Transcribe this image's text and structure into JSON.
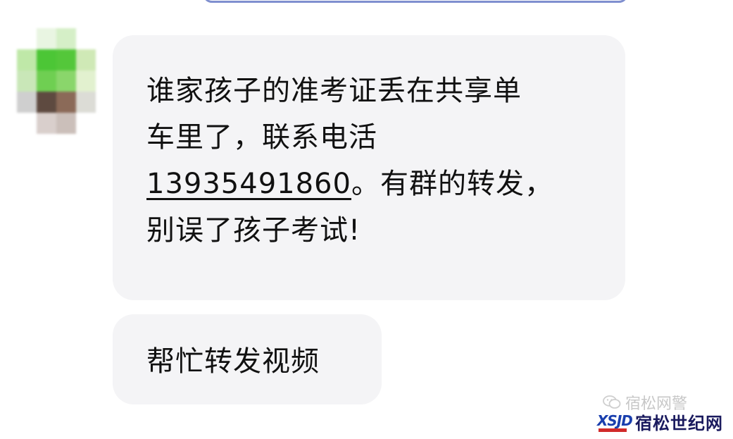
{
  "chat": {
    "messages": [
      {
        "line1": "谁家孩子的准考证丢在共享单",
        "line2": "车里了，联系电活",
        "phone": "13935491860",
        "line3_rest": "。有群的转发，",
        "line4": "别误了孩子考试!"
      },
      {
        "text": "帮忙转发视频"
      }
    ],
    "bubble_color": "#f4f4f6",
    "text_color": "#111111"
  },
  "avatar": {
    "icon": "blurred-avatar-icon",
    "pixel_colors": [
      "#ffffff",
      "#e9f5e2",
      "#d5efc7",
      "#ffffff",
      "#bfe8a8",
      "#4cc636",
      "#54c73a",
      "#cfe9b6",
      "#c9e7b8",
      "#6fcf52",
      "#8ad66b",
      "#e2f1cf",
      "#cfcfcf",
      "#5e4a40",
      "#8b6a58",
      "#dcdcd6",
      "#ffffff",
      "#d9cfcc",
      "#cbbfba",
      "#ffffff"
    ]
  },
  "watermark": {
    "top_text": "宿松网警",
    "logo_text": "XSJD",
    "brand": "宿松世纪网",
    "icon": "wechat-icon"
  }
}
